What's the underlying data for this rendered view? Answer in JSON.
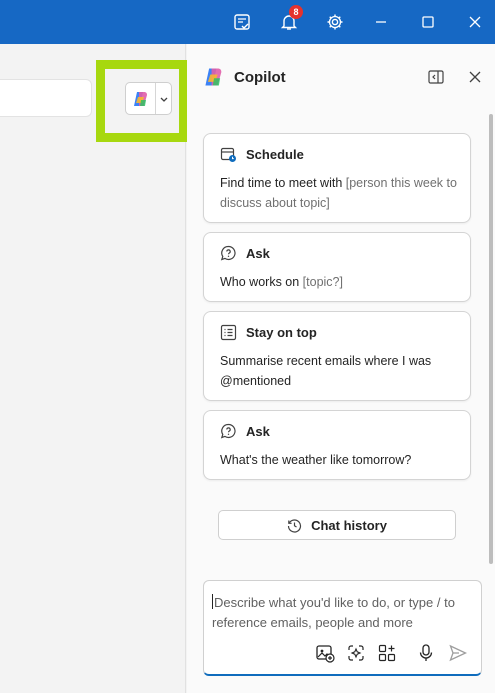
{
  "titlebar": {
    "notification_count": "8",
    "icons": [
      "tasks-icon",
      "bell-icon",
      "gear-icon",
      "minimize-icon",
      "maximize-icon",
      "close-icon"
    ]
  },
  "copilot": {
    "title": "Copilot",
    "cards": [
      {
        "icon": "calendar-clock-icon",
        "title": "Schedule",
        "text": "Find time to meet with ",
        "placeholder": "[person this week to discuss about topic]"
      },
      {
        "icon": "question-chat-icon",
        "title": "Ask",
        "text": "Who works on ",
        "placeholder": "[topic?]"
      },
      {
        "icon": "list-icon",
        "title": "Stay on top",
        "text": "Summarise recent emails where I was @mentioned",
        "placeholder": ""
      },
      {
        "icon": "question-chat-icon",
        "title": "Ask",
        "text": "What's the weather like tomorrow?",
        "placeholder": ""
      }
    ],
    "chat_history_label": "Chat history",
    "input_placeholder": "Describe what you'd like to do, or type / to reference emails, people and more"
  },
  "colors": {
    "titlebar": "#1668c4",
    "highlight": "#a7d80f",
    "badge": "#e5322d",
    "input_focus": "#0f6cbd"
  }
}
